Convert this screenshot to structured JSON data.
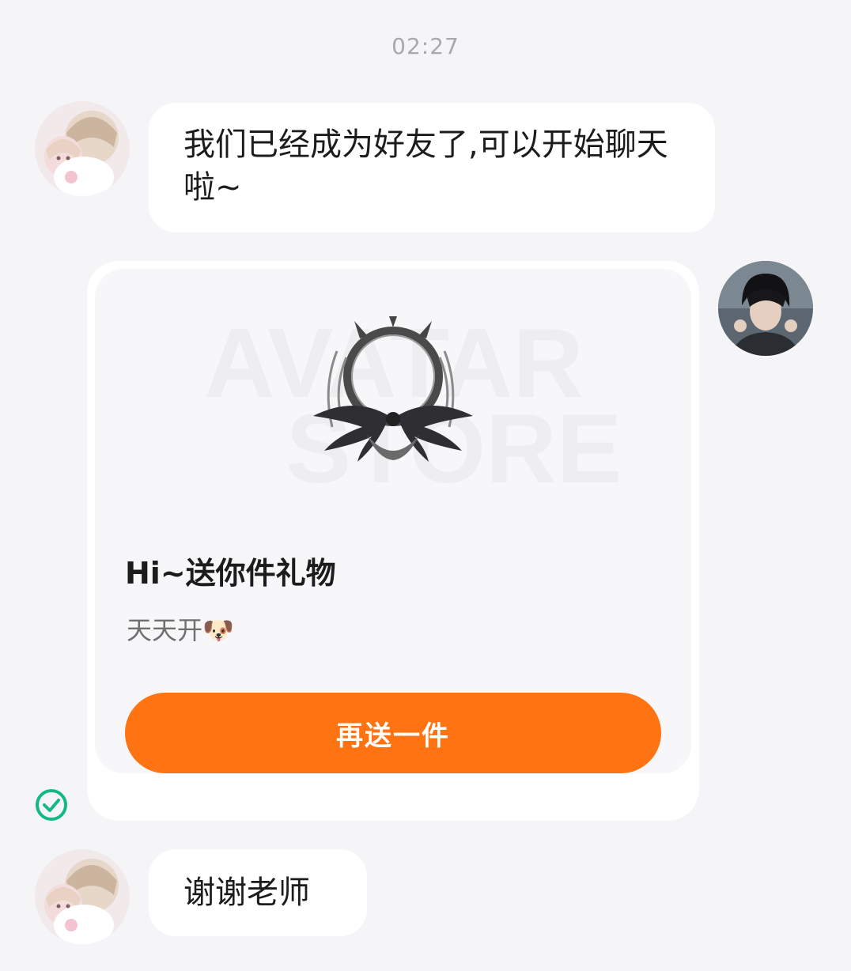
{
  "chat": {
    "timestamp": "02:27",
    "messages": [
      {
        "sender": "other",
        "text": "我们已经成为好友了,可以开始聊天啦~"
      },
      {
        "sender": "self",
        "type": "gift",
        "watermark_line1": "AVATAR",
        "watermark_line2": "STORE",
        "title": "Hi~送你件礼物",
        "subtitle": "天天开🐶",
        "button_label": "再送一件"
      },
      {
        "sender": "other",
        "text": "谢谢老师"
      }
    ],
    "read_status_icon": "check-circle-icon"
  },
  "colors": {
    "accent": "#ff7312",
    "read_check": "#12b886",
    "background": "#f5f5f7"
  }
}
